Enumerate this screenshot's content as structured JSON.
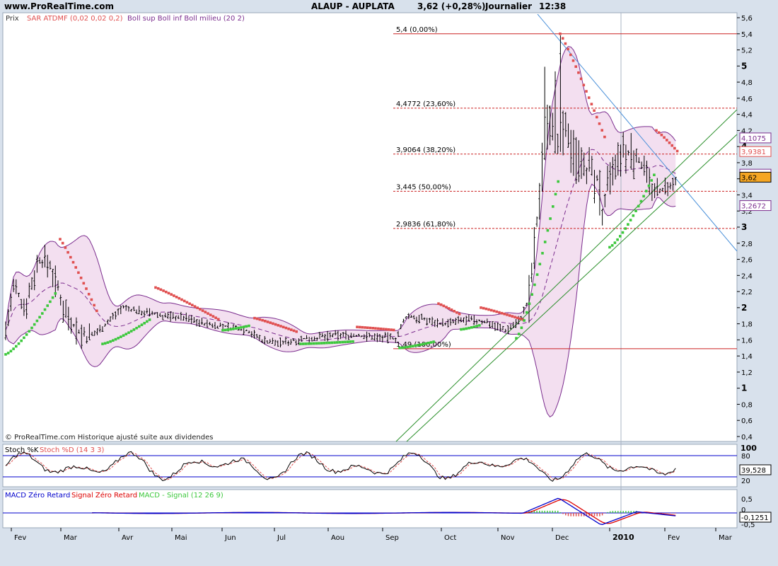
{
  "header": {
    "site": "www.ProRealTime.com",
    "title": "ALAUP - AUPLATA",
    "last": "3,62 (+0,28%)",
    "period": "Journalier",
    "time": "12:38"
  },
  "price_panel": {
    "label": "Prix",
    "sar_legend": "SAR ATDMF (0,02 0,02 0,2)",
    "boll_legend": "Boll sup Boll inf Boll milieu (20 2)",
    "footer": "© ProRealTime.com Historique ajusté suite aux dividendes",
    "y_ticks": [
      "5,6",
      "5,4",
      "5,2",
      "5",
      "4,8",
      "4,6",
      "4,4",
      "4,2",
      "4",
      "3,8",
      "3,6",
      "3,4",
      "3,2",
      "3",
      "2,8",
      "2,6",
      "2,4",
      "2,2",
      "2",
      "1,8",
      "1,6",
      "1,4",
      "1,2",
      "1",
      "0,8",
      "0,6",
      "0,4"
    ],
    "right_labels": [
      {
        "text": "4,1075",
        "value": 4.1075,
        "color": "#7b2d8e",
        "bg": "#ffffff"
      },
      {
        "text": "3,9381",
        "value": 3.9381,
        "color": "#e05050",
        "bg": "#ffffff"
      },
      {
        "text": "3,6573",
        "value": 3.6573,
        "color": "#7b2d8e",
        "bg": "#ffffff"
      },
      {
        "text": "3,62",
        "value": 3.62,
        "color": "#000000",
        "bg": "#f5a623"
      },
      {
        "text": "3,2672",
        "value": 3.2672,
        "color": "#7b2d8e",
        "bg": "#ffffff"
      }
    ],
    "fib_levels": [
      {
        "label": "5,4 (0,00%)",
        "value": 5.4,
        "solid": true
      },
      {
        "label": "4,4772 (23,60%)",
        "value": 4.4772,
        "solid": false
      },
      {
        "label": "3,9064 (38,20%)",
        "value": 3.9064,
        "solid": false
      },
      {
        "label": "3,445 (50,00%)",
        "value": 3.445,
        "solid": false
      },
      {
        "label": "2,9836 (61,80%)",
        "value": 2.9836,
        "solid": false
      },
      {
        "label": "1,49 (100,00%)",
        "value": 1.49,
        "solid": true
      }
    ]
  },
  "stoch_panel": {
    "label_k": "Stoch %K",
    "label_d": "Stoch %D (14 3 3)",
    "y_ticks": [
      "100",
      "80",
      "20"
    ],
    "value_label": "39,528"
  },
  "macd_panel": {
    "label_zr": "MACD Zéro Retard",
    "label_sig": "Signal Zéro Retard",
    "label_hist": "MACD - Signal (12 26 9)",
    "y_ticks": [
      "0,5",
      "0",
      "-0,5"
    ],
    "value_label": "-0,1251"
  },
  "x_axis": {
    "months": [
      "Fev",
      "Mar",
      "Avr",
      "Mai",
      "Jun",
      "Jul",
      "Aou",
      "Sep",
      "Oct",
      "Nov",
      "Dec",
      "2010",
      "Fev",
      "Mar"
    ]
  },
  "colors": {
    "background": "#ffffff",
    "frame": "#d8e1ec",
    "candle": "#000000",
    "boll": "#7b2d8e",
    "boll_fill": "#f3dff0",
    "sar_up": "#3cc83c",
    "sar_down": "#e05050",
    "fib": "#cc2222",
    "trend_green": "#2a8f2a",
    "trend_blue": "#4a90d9",
    "stoch_k": "#000000",
    "stoch_d": "#e05050",
    "macd": "#0000cc",
    "signal": "#dd0000",
    "hist": "#3cc83c"
  },
  "chart_data": {
    "type": "candlestick",
    "period": "Journalier",
    "y_range": [
      0.4,
      5.6
    ],
    "x_range_months": [
      "Fev",
      "Mar"
    ],
    "monthly_ranges": [
      {
        "month": "Fev",
        "low": 1.5,
        "high": 2.6
      },
      {
        "month": "Mar",
        "low": 1.55,
        "high": 2.85
      },
      {
        "month": "Avr",
        "low": 1.75,
        "high": 2.25
      },
      {
        "month": "Mai",
        "low": 1.8,
        "high": 2.0
      },
      {
        "month": "Jun",
        "low": 1.55,
        "high": 1.85
      },
      {
        "month": "Jul",
        "low": 1.5,
        "high": 1.75
      },
      {
        "month": "Aou",
        "low": 1.55,
        "high": 1.75
      },
      {
        "month": "Sep",
        "low": 1.6,
        "high": 2.05
      },
      {
        "month": "Oct",
        "low": 1.65,
        "high": 2.0
      },
      {
        "month": "Nov",
        "low": 1.7,
        "high": 5.35
      },
      {
        "month": "Dec",
        "low": 2.75,
        "high": 5.35
      },
      {
        "month": "2010",
        "low": 3.35,
        "high": 4.2
      },
      {
        "month": "Fev",
        "low": 3.4,
        "high": 3.7
      }
    ],
    "last_close": 3.62,
    "bollinger_last": {
      "upper": 4.1075,
      "middle": 3.6573,
      "lower": 3.2672
    },
    "sar_last": 3.9381,
    "stoch_last": 39.528,
    "macd_last": -0.1251
  }
}
